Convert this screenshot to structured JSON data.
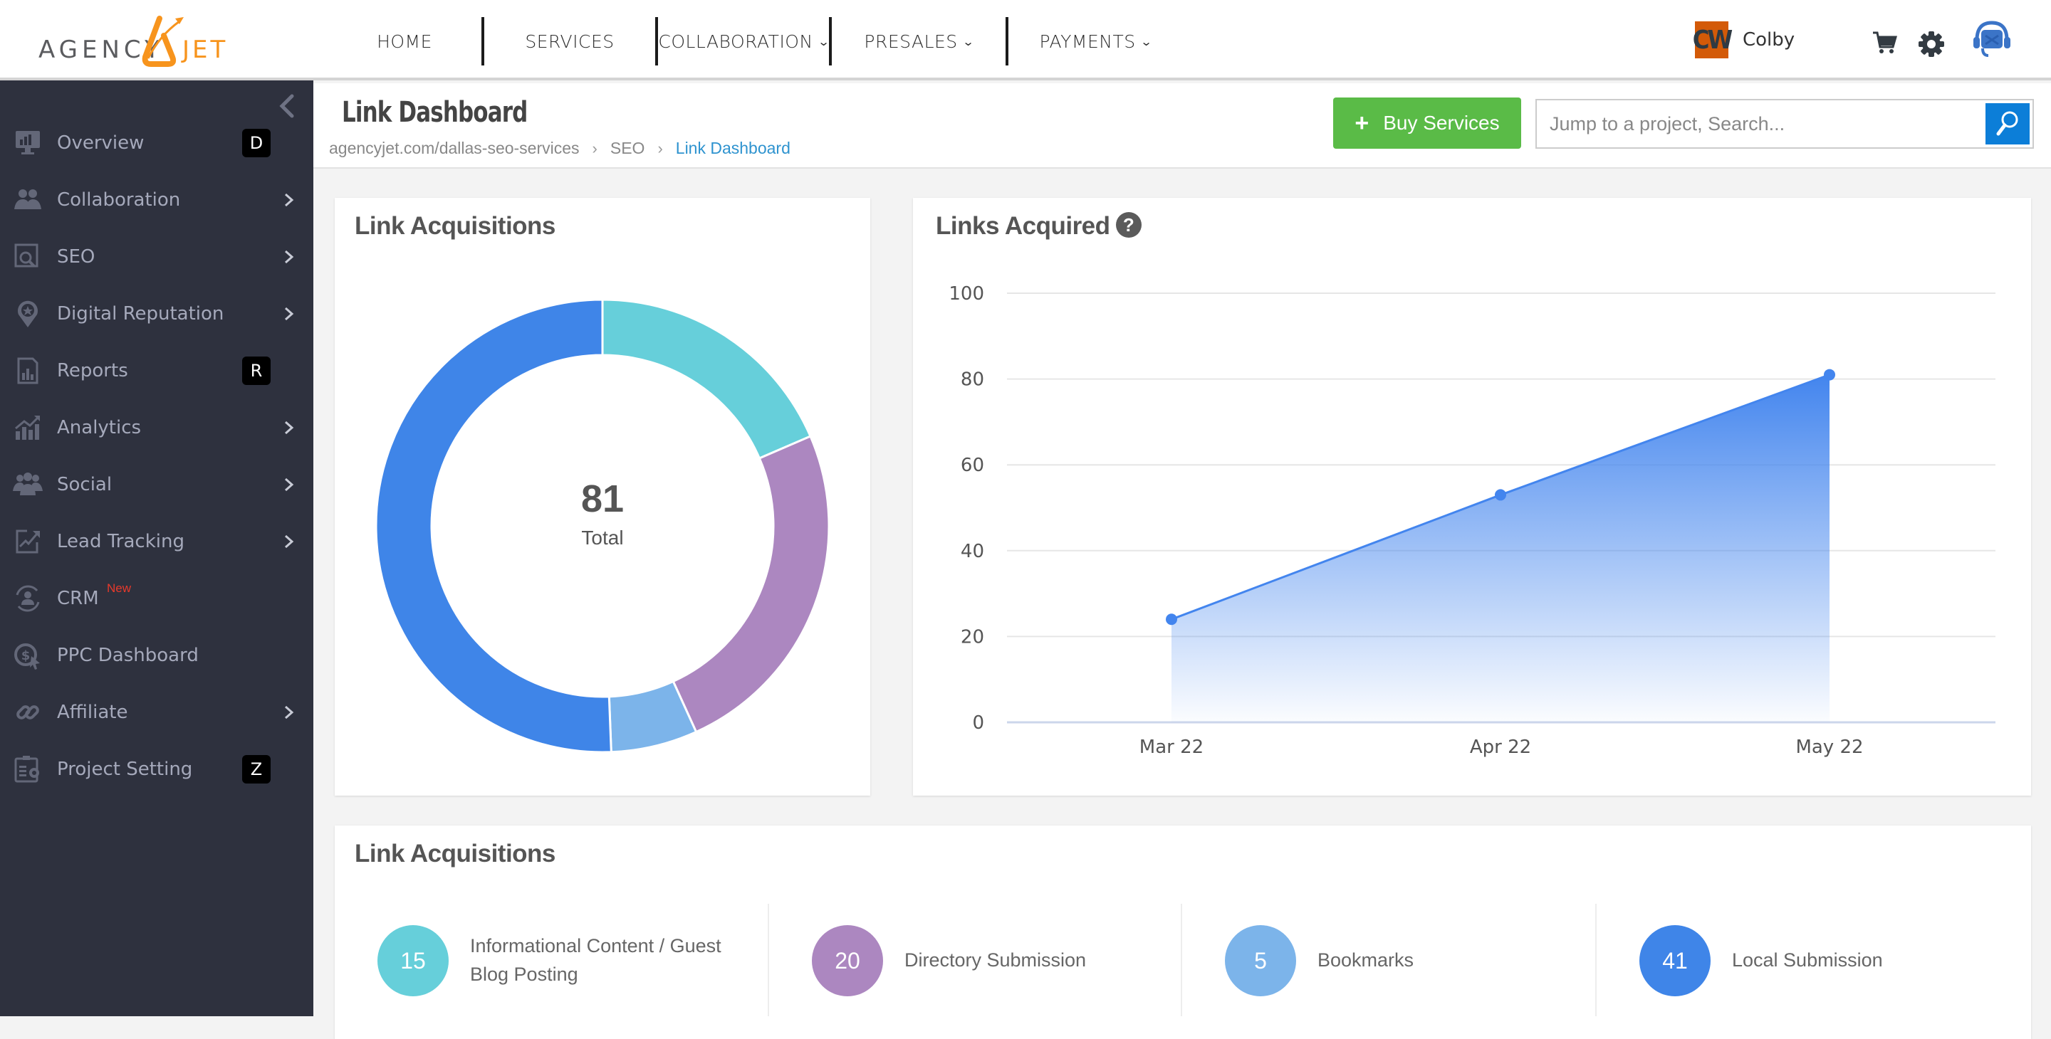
{
  "header": {
    "logo": {
      "left": "AGENCY",
      "right": "JET"
    },
    "nav": [
      {
        "label": "HOME",
        "has_dropdown": false
      },
      {
        "label": "SERVICES",
        "has_dropdown": false
      },
      {
        "label": "COLLABORATION",
        "has_dropdown": true
      },
      {
        "label": "PRESALES",
        "has_dropdown": true
      },
      {
        "label": "PAYMENTS",
        "has_dropdown": true
      }
    ],
    "user": {
      "initials": "CW",
      "name": "Colby"
    },
    "icons": [
      "cart-icon",
      "gear-icon",
      "support-headset-icon"
    ]
  },
  "sidebar": {
    "items": [
      {
        "label": "Overview",
        "icon": "monitor-chart-icon",
        "badge": "D",
        "chevron": false,
        "tag": ""
      },
      {
        "label": "Collaboration",
        "icon": "users-icon",
        "badge": "",
        "chevron": true,
        "tag": ""
      },
      {
        "label": "SEO",
        "icon": "seo-search-icon",
        "badge": "",
        "chevron": true,
        "tag": ""
      },
      {
        "label": "Digital Reputation",
        "icon": "location-star-icon",
        "badge": "",
        "chevron": true,
        "tag": ""
      },
      {
        "label": "Reports",
        "icon": "report-icon",
        "badge": "R",
        "chevron": false,
        "tag": ""
      },
      {
        "label": "Analytics",
        "icon": "analytics-icon",
        "badge": "",
        "chevron": true,
        "tag": ""
      },
      {
        "label": "Social",
        "icon": "social-group-icon",
        "badge": "",
        "chevron": true,
        "tag": ""
      },
      {
        "label": "Lead Tracking",
        "icon": "lead-tracking-icon",
        "badge": "",
        "chevron": true,
        "tag": ""
      },
      {
        "label": "CRM",
        "icon": "crm-icon",
        "badge": "",
        "chevron": false,
        "tag": "New"
      },
      {
        "label": "PPC Dashboard",
        "icon": "ppc-dollar-icon",
        "badge": "",
        "chevron": false,
        "tag": ""
      },
      {
        "label": "Affiliate",
        "icon": "link-icon",
        "badge": "",
        "chevron": true,
        "tag": ""
      },
      {
        "label": "Project Setting",
        "icon": "project-setting-icon",
        "badge": "Z",
        "chevron": false,
        "tag": ""
      }
    ]
  },
  "page": {
    "title": "Link Dashboard",
    "breadcrumb": [
      "agencyjet.com/dallas-seo-services",
      "SEO",
      "Link Dashboard"
    ],
    "buy_button": "Buy Services",
    "search_placeholder": "Jump to a project, Search..."
  },
  "donut_card": {
    "title": "Link Acquisitions",
    "center_value": "81",
    "center_label": "Total"
  },
  "line_card": {
    "title": "Links Acquired"
  },
  "legend_card": {
    "title": "Link Acquisitions",
    "items": [
      {
        "value": "15",
        "label": "Informational Content / Guest Blog Posting",
        "color": "#66cfda"
      },
      {
        "value": "20",
        "label": "Directory Submission",
        "color": "#ac87c0"
      },
      {
        "value": "5",
        "label": "Bookmarks",
        "color": "#7cb4ea"
      },
      {
        "value": "41",
        "label": "Local Submission",
        "color": "#3f85e8"
      }
    ]
  },
  "chart_data": [
    {
      "type": "pie",
      "title": "Link Acquisitions",
      "donut": true,
      "center_text": "81 Total",
      "categories": [
        "Informational Content / Guest Blog Posting",
        "Directory Submission",
        "Bookmarks",
        "Local Submission"
      ],
      "values": [
        15,
        20,
        5,
        41
      ],
      "colors": [
        "#66cfda",
        "#ac87c0",
        "#7cb4ea",
        "#3f85e8"
      ]
    },
    {
      "type": "area",
      "title": "Links Acquired",
      "categories": [
        "Mar 22",
        "Apr 22",
        "May 22"
      ],
      "series": [
        {
          "name": "Links Acquired",
          "values": [
            24,
            53,
            81
          ],
          "color": "#4385ee"
        }
      ],
      "yticks": [
        0,
        20,
        40,
        60,
        80,
        100
      ],
      "ylim": [
        0,
        100
      ],
      "grid": true,
      "legend": "none"
    }
  ]
}
